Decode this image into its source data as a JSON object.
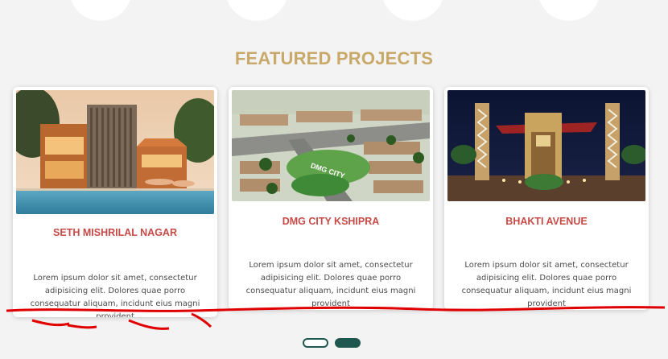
{
  "section": {
    "title": "FEATURED PROJECTS"
  },
  "projects": [
    {
      "name": "SETH MISHRILAL NAGAR",
      "description": "Lorem ipsum dolor sit amet, consectetur adipisicing elit. Dolores quae porro consequatur aliquam, incidunt eius magni provident"
    },
    {
      "name": "DMG CITY KSHIPRA",
      "description": "Lorem ipsum dolor sit amet, consectetur adipisicing elit. Dolores quae porro consequatur aliquam, incidunt eius magni provident",
      "image_text": "DMG CITY"
    },
    {
      "name": "BHAKTI AVENUE",
      "description": "Lorem ipsum dolor sit amet, consectetur adipisicing elit. Dolores quae porro consequatur aliquam, incidunt eius magni provident"
    }
  ],
  "carousel": {
    "pages": 2,
    "active_index": 1
  },
  "colors": {
    "title": "#c9a96a",
    "project_name": "#c74a46",
    "dot": "#1f5750",
    "annotation": "#e00000"
  }
}
